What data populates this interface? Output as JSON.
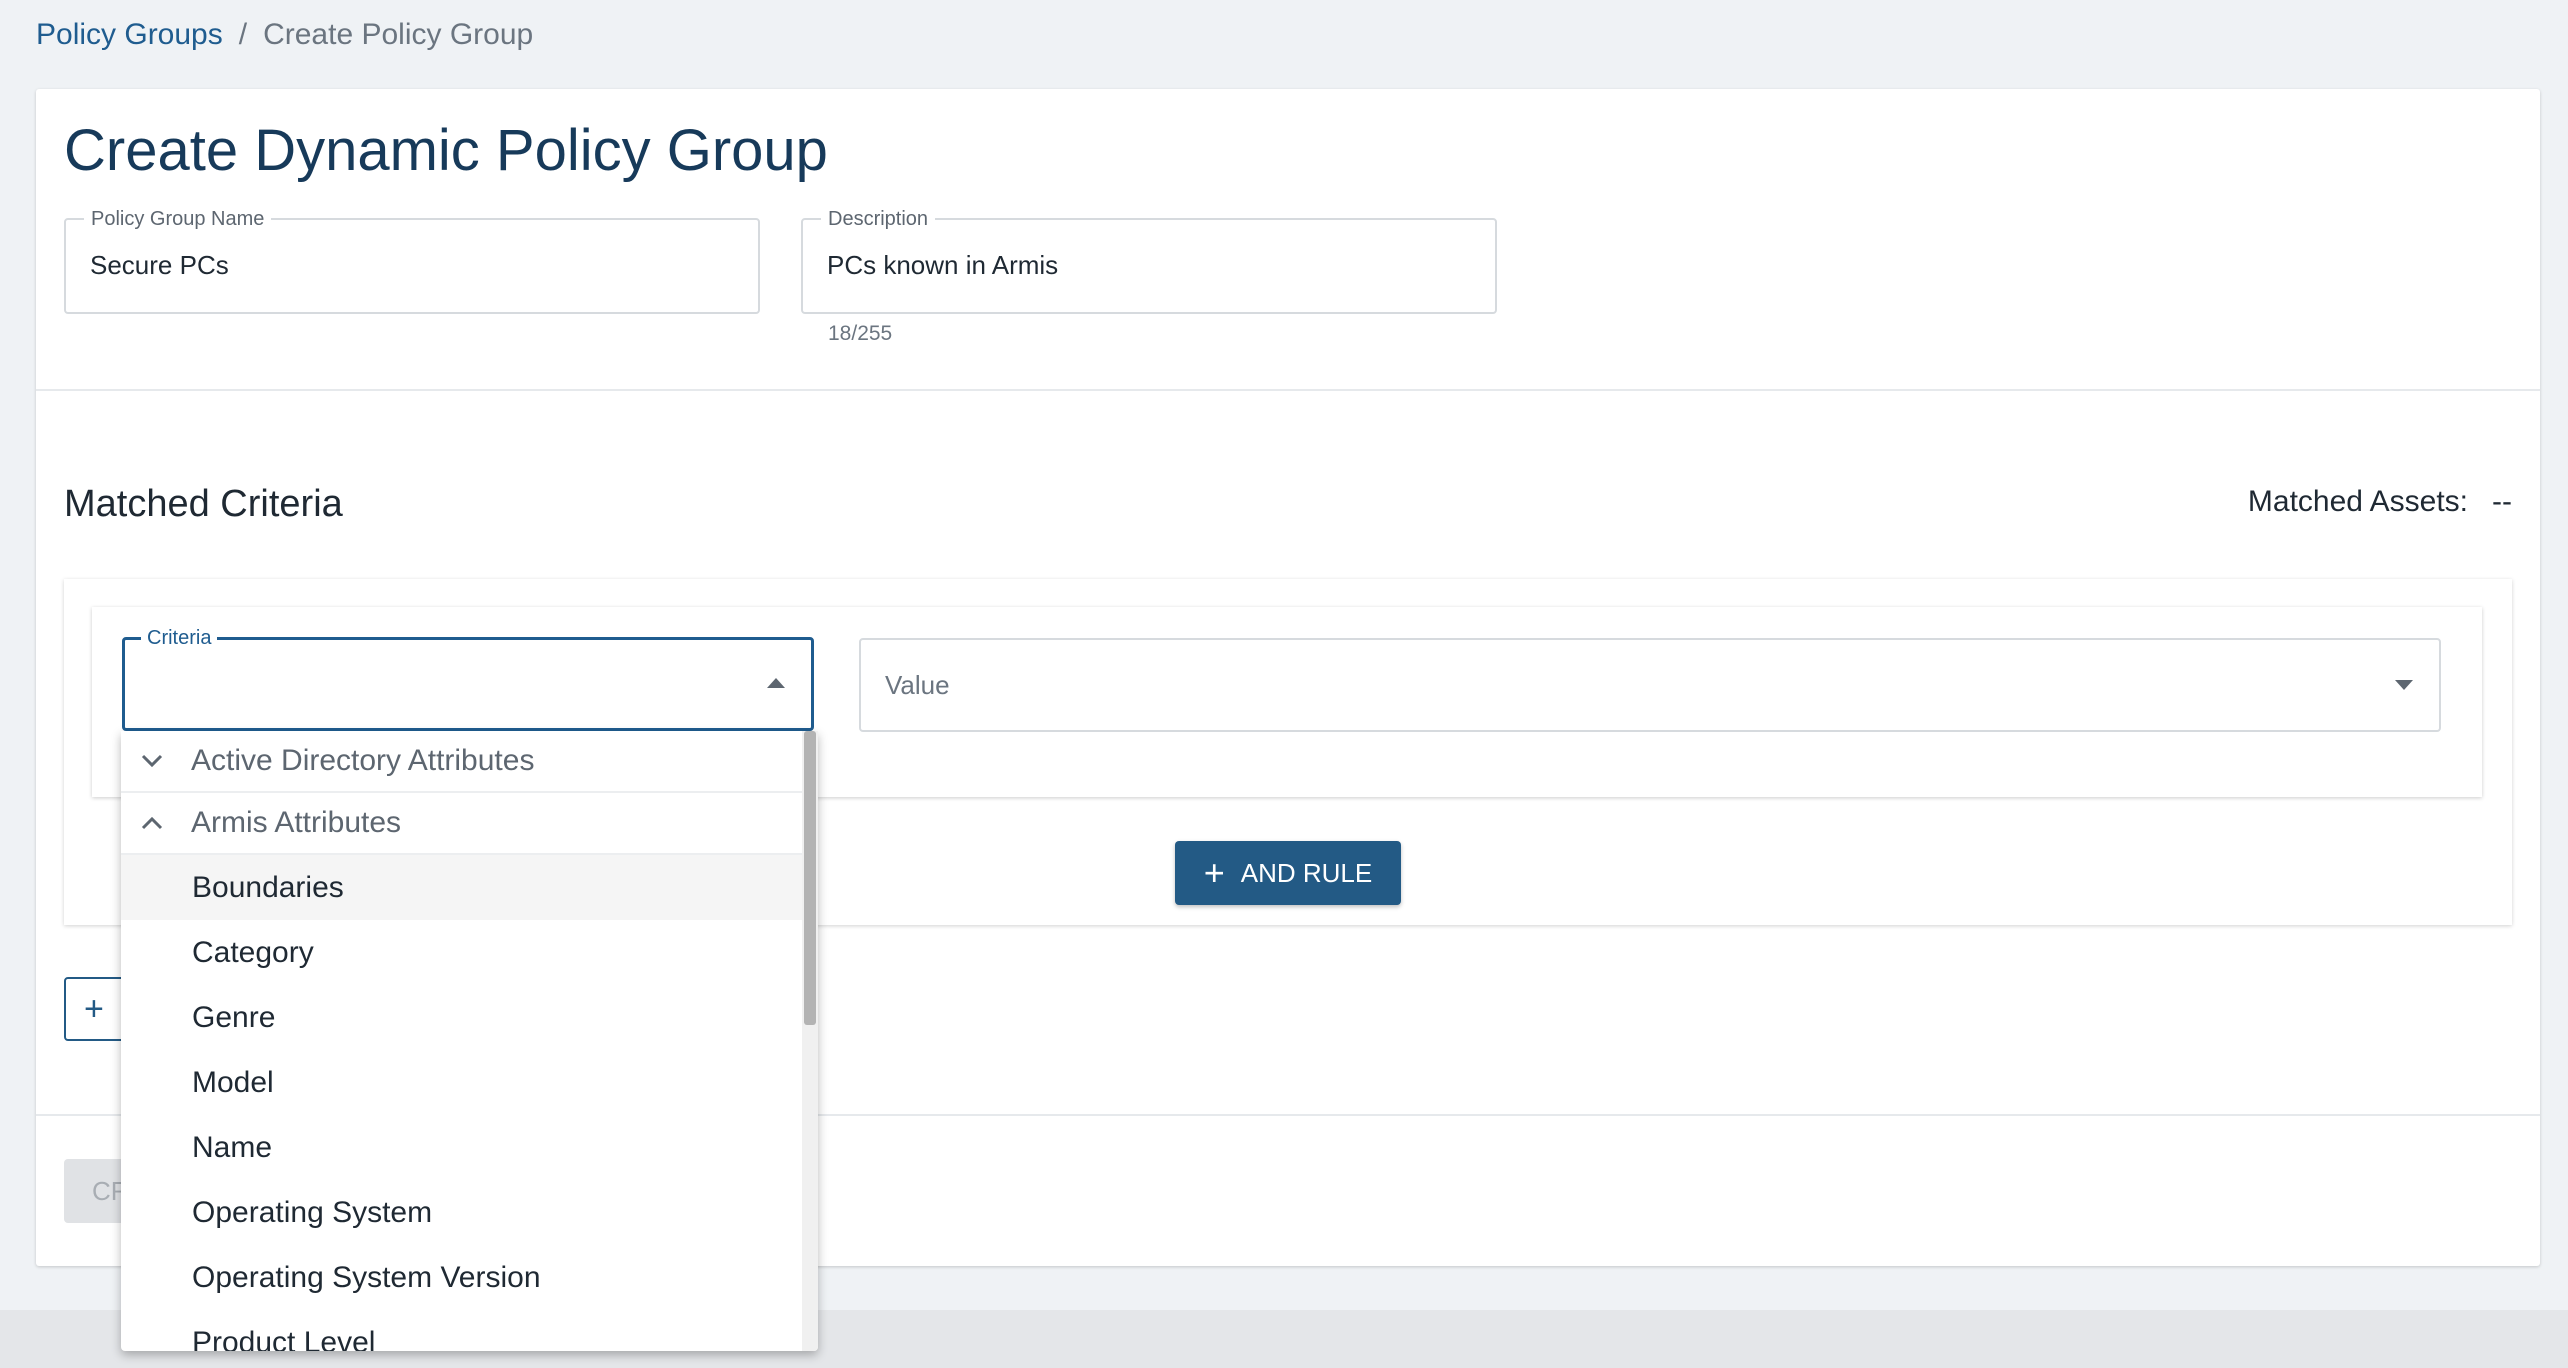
{
  "breadcrumb": {
    "parent": "Policy Groups",
    "separator": "/",
    "current": "Create Policy Group"
  },
  "page": {
    "title": "Create Dynamic Policy Group"
  },
  "form": {
    "name": {
      "label": "Policy Group Name",
      "value": "Secure PCs"
    },
    "description": {
      "label": "Description",
      "value": "PCs known in Armis",
      "counter": "18/255"
    }
  },
  "criteria_section": {
    "title": "Matched Criteria",
    "matched_assets_label": "Matched Assets:",
    "matched_assets_value": "--"
  },
  "rule": {
    "criteria_label": "Criteria",
    "criteria_value": "",
    "value_placeholder": "Value",
    "and_rule_label": "AND RULE"
  },
  "or_rule": {
    "icon": "+"
  },
  "footer": {
    "create_label": "CR"
  },
  "dropdown": {
    "groups": [
      {
        "label": "Active Directory Attributes",
        "expanded": false,
        "icon": "chevron-down-icon"
      },
      {
        "label": "Armis Attributes",
        "expanded": true,
        "icon": "chevron-up-icon"
      }
    ],
    "items": [
      "Boundaries",
      "Category",
      "Genre",
      "Model",
      "Name",
      "Operating System",
      "Operating System Version",
      "Product Level"
    ],
    "hovered_item": "Boundaries"
  },
  "colors": {
    "accent": "#235a85",
    "focus": "#1f5c8f",
    "title": "#173a5a",
    "background": "#eff2f5"
  }
}
